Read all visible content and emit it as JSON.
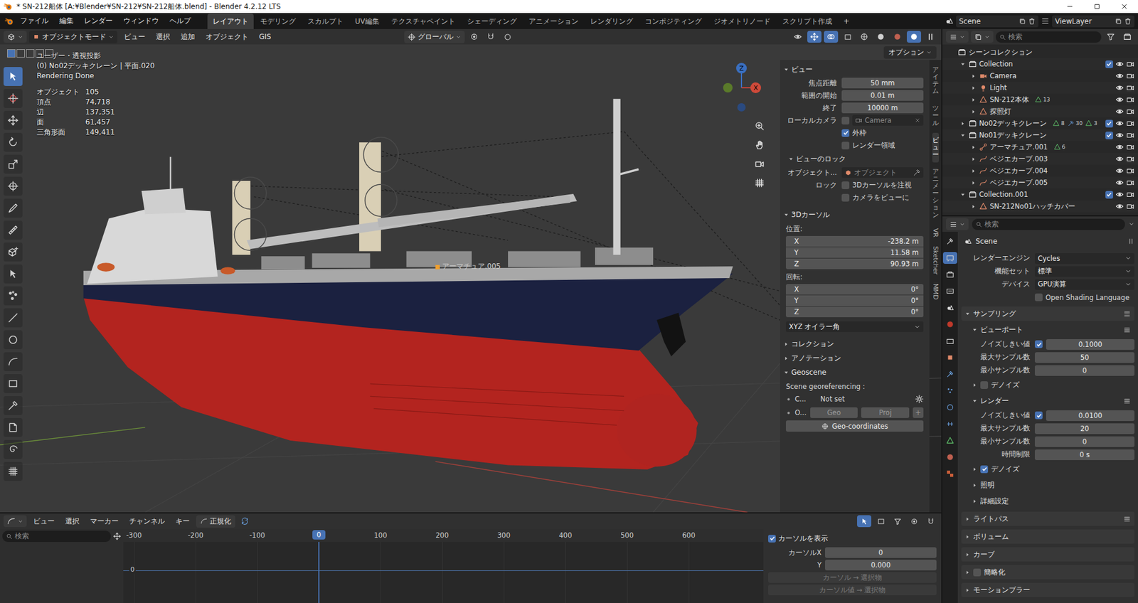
{
  "window": {
    "title": "* SN-212船体 [A:¥Blender¥SN-212¥SN-212船体.blend] - Blender 4.2.12 LTS"
  },
  "menu": {
    "items": [
      "ファイル",
      "編集",
      "レンダー",
      "ウィンドウ",
      "ヘルプ"
    ],
    "workspaces": [
      {
        "label": "レイアウト",
        "selected": true
      },
      {
        "label": "モデリング",
        "selected": false
      },
      {
        "label": "スカルプト",
        "selected": false
      },
      {
        "label": "UV編集",
        "selected": false
      },
      {
        "label": "テクスチャペイント",
        "selected": false
      },
      {
        "label": "シェーディング",
        "selected": false
      },
      {
        "label": "アニメーション",
        "selected": false
      },
      {
        "label": "レンダリング",
        "selected": false
      },
      {
        "label": "コンポジティング",
        "selected": false
      },
      {
        "label": "ジオメトリノード",
        "selected": false
      },
      {
        "label": "スクリプト作成",
        "selected": false
      }
    ],
    "add": "+",
    "scene": "Scene",
    "view_layer": "ViewLayer"
  },
  "viewport": {
    "mode": "オブジェクトモード",
    "menus": [
      "ビュー",
      "選択",
      "追加",
      "オブジェクト",
      "GIS"
    ],
    "orientation": "グローバル",
    "options": "オプション",
    "view_name": "ユーザー・透視投影",
    "context": "(0) No02デッキクレーン | 平面.020",
    "status": "Rendering Done",
    "stats": [
      {
        "label": "オブジェクト",
        "value": "105"
      },
      {
        "label": "頂点",
        "value": "74,718"
      },
      {
        "label": "辺",
        "value": "137,351"
      },
      {
        "label": "面",
        "value": "61,457"
      },
      {
        "label": "三角形面",
        "value": "149,411"
      }
    ],
    "gizmo": {
      "z": "Z",
      "x": "X"
    },
    "object_label": "アーマチュア.005",
    "tools": [
      {
        "selected": true
      },
      {
        "selected": false
      },
      {
        "selected": false
      },
      {
        "selected": false
      },
      {
        "selected": false
      },
      {
        "selected": false
      },
      {
        "selected": false
      },
      {
        "selected": false
      },
      {
        "selected": false
      },
      {
        "selected": false
      },
      {
        "selected": false
      },
      {
        "selected": false
      },
      {
        "selected": false
      },
      {
        "selected": false
      },
      {
        "selected": false
      },
      {
        "selected": false
      },
      {
        "selected": false
      },
      {
        "selected": false
      },
      {
        "selected": false
      }
    ]
  },
  "sidebar": {
    "tabs": [
      {
        "label": "アイテム",
        "selected": false,
        "kind": "cjk"
      },
      {
        "label": "ツール",
        "selected": false,
        "kind": "cjk"
      },
      {
        "label": "ビュー",
        "selected": true,
        "kind": "cjk"
      },
      {
        "label": "アニメーション",
        "selected": false,
        "kind": "cjk"
      },
      {
        "label": "VR",
        "selected": false,
        "kind": "latin"
      },
      {
        "label": "Sketcher",
        "selected": false,
        "kind": "latin"
      },
      {
        "label": "MMD",
        "selected": false,
        "kind": "latin"
      }
    ],
    "sections": [
      {
        "title": "ビュー",
        "expanded": true,
        "rows": [
          {
            "kind": "field",
            "label": "焦点距離",
            "value": "50 mm"
          },
          {
            "kind": "field",
            "label": "範囲の開始",
            "value": "0.01 m"
          },
          {
            "kind": "field",
            "label": "終了",
            "value": "10000 m"
          },
          {
            "kind": "camera",
            "label": "ローカルカメラ",
            "checked": false,
            "value": "Camera"
          },
          {
            "kind": "check",
            "label": "外枠",
            "checked": true,
            "prefix": ""
          },
          {
            "kind": "check",
            "label": "レンダー領域",
            "checked": false,
            "prefix": ""
          },
          {
            "kind": "subheader",
            "label": "ビューのロック",
            "expanded": true
          },
          {
            "kind": "picker",
            "label": "オブジェクト...",
            "placeholder": "オブジェクト"
          },
          {
            "kind": "check",
            "label": "3Dカーソルを注視",
            "checked": false,
            "prefix": "ロック"
          },
          {
            "kind": "check",
            "label": "カメラをビューに",
            "checked": false,
            "prefix": ""
          }
        ]
      },
      {
        "title": "3Dカーソル",
        "expanded": true,
        "rows": [
          {
            "kind": "caption",
            "label": "位置:"
          },
          {
            "kind": "axes",
            "items": [
              {
                "label": "X",
                "value": "-238.2 m"
              },
              {
                "label": "Y",
                "value": "11.58 m"
              },
              {
                "label": "Z",
                "value": "90.93 m"
              }
            ]
          },
          {
            "kind": "caption",
            "label": "回転:"
          },
          {
            "kind": "axes",
            "items": [
              {
                "label": "X",
                "value": "0°"
              },
              {
                "label": "Y",
                "value": "0°"
              },
              {
                "label": "Z",
                "value": "0°"
              }
            ]
          },
          {
            "kind": "select",
            "value": "XYZ オイラー角"
          }
        ]
      },
      {
        "title": "コレクション",
        "expanded": false,
        "rows": []
      },
      {
        "title": "アノテーション",
        "expanded": false,
        "rows": []
      },
      {
        "title": "Geoscene",
        "expanded": true,
        "rows": [
          {
            "kind": "caption",
            "label": "Scene georeferencing :"
          },
          {
            "kind": "geo_crs",
            "label": "C...",
            "value": "Not set"
          },
          {
            "kind": "geo_origin",
            "label": "O...",
            "buttons": [
              "Geo",
              "Proj"
            ],
            "add": "+"
          },
          {
            "kind": "button",
            "label": "Geo-coordinates"
          }
        ]
      }
    ]
  },
  "outliner": {
    "search": "検索",
    "rows": [
      {
        "label": "シーンコレクション",
        "depth": 0,
        "kind": "scene",
        "toggle": "none",
        "checked": null,
        "visible": null,
        "extras": []
      },
      {
        "label": "Collection",
        "depth": 1,
        "kind": "collection",
        "toggle": "open",
        "checked": true,
        "visible": true,
        "extras": []
      },
      {
        "label": "Camera",
        "depth": 2,
        "kind": "camera",
        "toggle": "closed",
        "checked": null,
        "visible": true,
        "extras": []
      },
      {
        "label": "Light",
        "depth": 2,
        "kind": "light",
        "toggle": "closed",
        "checked": null,
        "visible": true,
        "extras": []
      },
      {
        "label": "SN-212本体",
        "depth": 2,
        "kind": "mesh",
        "toggle": "closed",
        "checked": null,
        "visible": true,
        "extras": [
          "13"
        ]
      },
      {
        "label": "探照灯",
        "depth": 2,
        "kind": "mesh",
        "toggle": "closed",
        "checked": null,
        "visible": true,
        "extras": []
      },
      {
        "label": "No02デッキクレーン",
        "depth": 1,
        "kind": "collection",
        "toggle": "closed",
        "checked": true,
        "visible": true,
        "extras": [
          "8",
          "30",
          "3"
        ]
      },
      {
        "label": "No01デッキクレーン",
        "depth": 1,
        "kind": "collection",
        "toggle": "open",
        "checked": true,
        "visible": true,
        "extras": []
      },
      {
        "label": "アーマチュア.001",
        "depth": 2,
        "kind": "armature",
        "toggle": "closed",
        "checked": null,
        "visible": true,
        "extras": [
          "6"
        ]
      },
      {
        "label": "ベジエカーブ.003",
        "depth": 2,
        "kind": "curve",
        "toggle": "closed",
        "checked": null,
        "visible": true,
        "extras": []
      },
      {
        "label": "ベジエカーブ.004",
        "depth": 2,
        "kind": "curve",
        "toggle": "closed",
        "checked": null,
        "visible": true,
        "extras": []
      },
      {
        "label": "ベジエカーブ.005",
        "depth": 2,
        "kind": "curve",
        "toggle": "closed",
        "checked": null,
        "visible": true,
        "extras": []
      },
      {
        "label": "Collection.001",
        "depth": 1,
        "kind": "collection",
        "toggle": "open",
        "checked": true,
        "visible": true,
        "extras": []
      },
      {
        "label": "SN-212No01ハッチカバー",
        "depth": 2,
        "kind": "mesh",
        "toggle": "closed",
        "checked": null,
        "visible": true,
        "extras": []
      }
    ]
  },
  "properties": {
    "search": "検索",
    "title": "Scene",
    "rows": [
      {
        "kind": "select",
        "label": "レンダーエンジン",
        "value": "Cycles"
      },
      {
        "kind": "select",
        "label": "機能セット",
        "value": "標準"
      },
      {
        "kind": "select",
        "label": "デバイス",
        "value": "GPU演算"
      },
      {
        "kind": "check",
        "label": "Open Shading Language",
        "checked": false
      },
      {
        "kind": "panel",
        "label": "サンプリング",
        "expanded": true,
        "presets": true
      },
      {
        "kind": "subpanel",
        "label": "ビューポート",
        "expanded": true,
        "presets": true
      },
      {
        "kind": "num_check",
        "label": "ノイズしきい値",
        "checked": true,
        "value": "0.1000"
      },
      {
        "kind": "num",
        "label": "最大サンプル数",
        "value": "50"
      },
      {
        "kind": "num",
        "label": "最小サンプル数",
        "value": "0"
      },
      {
        "kind": "subpanel",
        "label": "デノイズ",
        "expanded": false,
        "presets": false,
        "checked": false
      },
      {
        "kind": "subpanel",
        "label": "レンダー",
        "expanded": true,
        "presets": true
      },
      {
        "kind": "num_check",
        "label": "ノイズしきい値",
        "checked": true,
        "value": "0.0100"
      },
      {
        "kind": "num",
        "label": "最大サンプル数",
        "value": "20"
      },
      {
        "kind": "num",
        "label": "最小サンプル数",
        "value": "0"
      },
      {
        "kind": "num",
        "label": "時間制限",
        "value": "0 s"
      },
      {
        "kind": "subpanel",
        "label": "デノイズ",
        "expanded": false,
        "presets": false,
        "checked": true
      },
      {
        "kind": "subpanel",
        "label": "照明",
        "expanded": false,
        "presets": false
      },
      {
        "kind": "subpanel",
        "label": "詳細設定",
        "expanded": false,
        "presets": false
      },
      {
        "kind": "panel",
        "label": "ライトパス",
        "expanded": false,
        "presets": true
      },
      {
        "kind": "panel",
        "label": "ボリューム",
        "expanded": false,
        "presets": false
      },
      {
        "kind": "panel",
        "label": "カーブ",
        "expanded": false,
        "presets": false
      },
      {
        "kind": "panel",
        "label": "簡略化",
        "expanded": false,
        "presets": false,
        "checked": false
      },
      {
        "kind": "panel",
        "label": "モーションブラー",
        "expanded": false,
        "presets": false
      }
    ]
  },
  "timeline": {
    "menus": [
      "ビュー",
      "選択",
      "マーカー",
      "チャンネル",
      "キー"
    ],
    "normalize": {
      "label": "正規化",
      "checked": false
    },
    "search": "検索",
    "ticks": [
      "-300",
      "-200",
      "-100",
      "0",
      "100",
      "200",
      "300",
      "400",
      "500",
      "600"
    ],
    "current": "0",
    "channel_value": "0",
    "side": {
      "show_cursor": {
        "label": "カーソルを表示",
        "checked": true
      },
      "fields": [
        {
          "label": "カーソルX",
          "value": "0"
        },
        {
          "label": "Y",
          "value": "0.000"
        }
      ],
      "buttons": [
        {
          "label": "カーソル → 選択物",
          "disabled": true
        },
        {
          "label": "カーソル値 → 選択物",
          "disabled": true
        }
      ]
    }
  }
}
